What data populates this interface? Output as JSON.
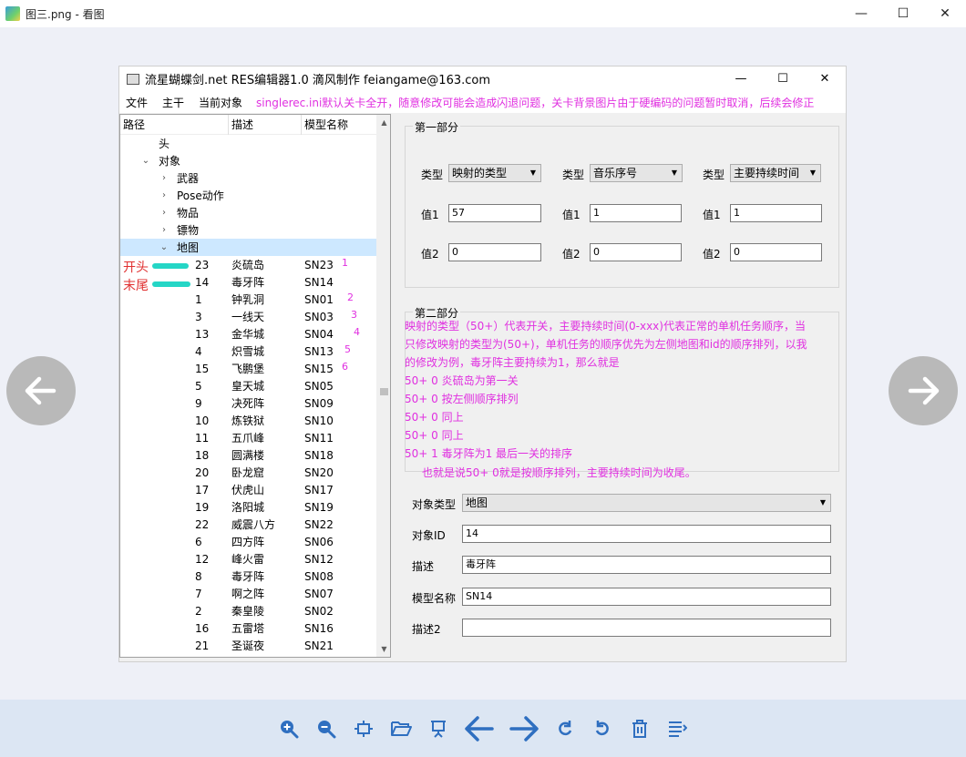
{
  "viewer": {
    "title": "图三.png - 看图",
    "min": "—",
    "max": "☐",
    "close": "✕"
  },
  "app": {
    "title": "流星蝴蝶剑.net RES编辑器1.0 滴风制作 feiangame@163.com",
    "min": "—",
    "max": "☐",
    "close": "✕"
  },
  "menu": {
    "file": "文件",
    "main": "主干",
    "current": "当前对象",
    "notice": "singlerec.ini默认关卡全开，随意修改可能会造成闪退问题，关卡背景图片由于硬编码的问题暂时取消，后续会修正"
  },
  "tree": {
    "headers": [
      "路径",
      "描述",
      "模型名称"
    ],
    "root_head": "头",
    "obj": "对象",
    "children": [
      "武器",
      "Pose动作",
      "物品",
      "镖物",
      "地图"
    ],
    "rows": [
      {
        "id": "23",
        "desc": "炎硫岛",
        "model": "SN23",
        "note": "1"
      },
      {
        "id": "14",
        "desc": "毒牙阵",
        "model": "SN14",
        "note": ""
      },
      {
        "id": "1",
        "desc": "钟乳洞",
        "model": "SN01",
        "note": "2"
      },
      {
        "id": "3",
        "desc": "一线天",
        "model": "SN03",
        "note": "3"
      },
      {
        "id": "13",
        "desc": "金华城",
        "model": "SN04",
        "note": "4"
      },
      {
        "id": "4",
        "desc": "炽雪城",
        "model": "SN13",
        "note": "5"
      },
      {
        "id": "15",
        "desc": "飞鹏堡",
        "model": "SN15",
        "note": "6"
      },
      {
        "id": "5",
        "desc": "皇天城",
        "model": "SN05",
        "note": ""
      },
      {
        "id": "9",
        "desc": "决死阵",
        "model": "SN09",
        "note": ""
      },
      {
        "id": "10",
        "desc": "炼铁狱",
        "model": "SN10",
        "note": ""
      },
      {
        "id": "11",
        "desc": "五爪峰",
        "model": "SN11",
        "note": ""
      },
      {
        "id": "18",
        "desc": "圆满楼",
        "model": "SN18",
        "note": ""
      },
      {
        "id": "20",
        "desc": "卧龙窟",
        "model": "SN20",
        "note": ""
      },
      {
        "id": "17",
        "desc": "伏虎山",
        "model": "SN17",
        "note": ""
      },
      {
        "id": "19",
        "desc": "洛阳城",
        "model": "SN19",
        "note": ""
      },
      {
        "id": "22",
        "desc": "威震八方",
        "model": "SN22",
        "note": ""
      },
      {
        "id": "6",
        "desc": "四方阵",
        "model": "SN06",
        "note": ""
      },
      {
        "id": "12",
        "desc": "峰火雷",
        "model": "SN12",
        "note": ""
      },
      {
        "id": "8",
        "desc": "毒牙阵",
        "model": "SN08",
        "note": ""
      },
      {
        "id": "7",
        "desc": "啊之阵",
        "model": "SN07",
        "note": ""
      },
      {
        "id": "2",
        "desc": "秦皇陵",
        "model": "SN02",
        "note": ""
      },
      {
        "id": "16",
        "desc": "五雷塔",
        "model": "SN16",
        "note": ""
      },
      {
        "id": "21",
        "desc": "圣诞夜",
        "model": "SN21",
        "note": ""
      }
    ]
  },
  "annotations": {
    "start": "开头",
    "end": "末尾"
  },
  "part1": {
    "title": "第一部分",
    "type_label": "类型",
    "v1_label": "值1",
    "v2_label": "值2",
    "cols": [
      {
        "type": "映射的类型",
        "v1": "57",
        "v2": "0"
      },
      {
        "type": "音乐序号",
        "v1": "1",
        "v2": "0"
      },
      {
        "type": "主要持续时间",
        "v1": "1",
        "v2": "0"
      }
    ]
  },
  "part2": {
    "title": "第二部分",
    "lines": [
      "映射的类型（50+）代表开关，主要持续时间(0-xxx)代表正常的单机任务顺序，当",
      "只修改映射的类型为(50+)，单机任务的顺序优先为左侧地图和id的顺序排列，以我",
      "的修改为例，毒牙阵主要持续为1，那么就是",
      "50+ 0  炎硫岛为第一关",
      "50+ 0  按左侧顺序排列",
      "50+ 0  同上",
      "50+ 0  同上",
      "50+ 1  毒牙阵为1 最后一关的排序",
      "也就是说50+ 0就是按顺序排列，主要持续时间为收尾。"
    ]
  },
  "form": {
    "type_label": "对象类型",
    "type_value": "地图",
    "id_label": "对象ID",
    "id_value": "14",
    "desc_label": "描述",
    "desc_value": "毒牙阵",
    "model_label": "模型名称",
    "model_value": "SN14",
    "desc2_label": "描述2",
    "desc2_value": ""
  },
  "colors": {
    "pink": "#e030e0",
    "red": "#e03030",
    "teal": "#25d6c6",
    "accent": "#2f6fc0"
  }
}
